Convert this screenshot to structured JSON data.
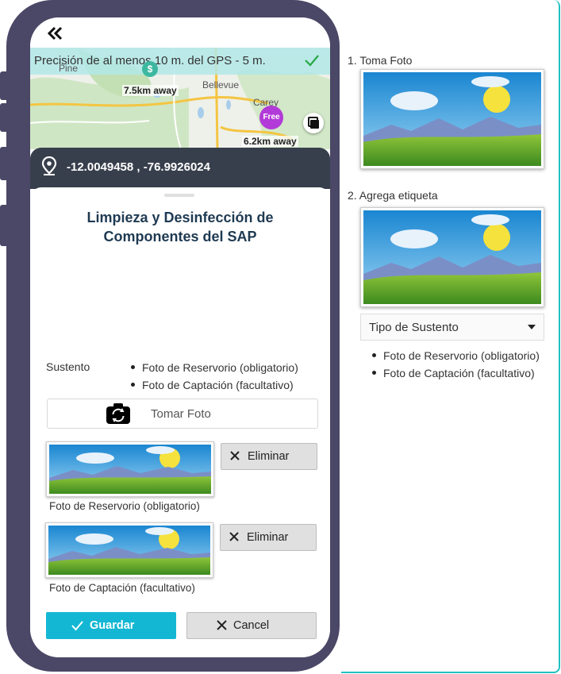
{
  "map": {
    "gps_text": "Precisión de al menos 10 m. del GPS - 5 m.",
    "labels": [
      "Pine",
      "Bellevue",
      "Carey"
    ],
    "pins": [
      {
        "distance": "7.5km away",
        "symbol": "$"
      },
      {
        "distance": "6.2km away",
        "symbol": "Free"
      }
    ]
  },
  "coords": "-12.0049458 , -76.9926024",
  "form": {
    "title": "Limpieza y Desinfección de Componentes del SAP",
    "sustento_label": "Sustento",
    "sustento_items": [
      "Foto de Reservorio (obligatorio)",
      "Foto de Captación (facultativo)"
    ],
    "take_photo": "Tomar Foto",
    "photos": [
      {
        "caption": "Foto de Reservorio (obligatorio)",
        "delete_label": "Eliminar"
      },
      {
        "caption": "Foto de Captación (facultativo)",
        "delete_label": "Eliminar"
      }
    ],
    "save_label": "Guardar",
    "cancel_label": "Cancel"
  },
  "panel": {
    "step1": "1. Toma Foto",
    "step2": "2. Agrega etiqueta",
    "select_value": "Tipo de Sustento",
    "items": [
      "Foto de Reservorio (obligatorio)",
      "Foto de Captación (facultativo)"
    ]
  },
  "colors": {
    "accent": "#13b7d3",
    "frame": "#4b4766",
    "panel_border": "#21c1c1",
    "title": "#1f3a52"
  }
}
